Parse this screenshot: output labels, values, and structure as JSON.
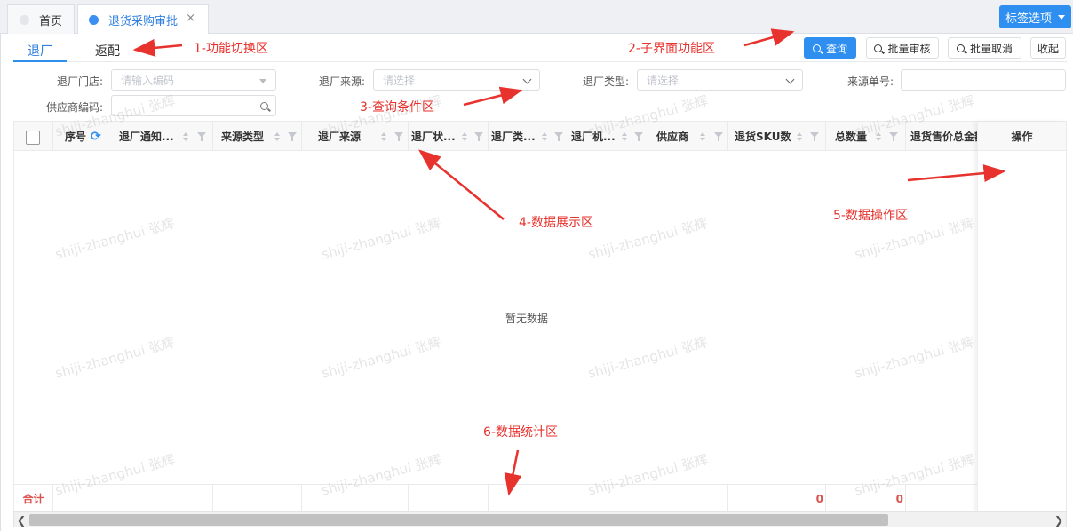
{
  "tabs": [
    {
      "label": "首页"
    },
    {
      "label": "退货采购审批",
      "close": "×"
    }
  ],
  "label_options": "标签选项",
  "func_tabs": [
    "退厂",
    "返配"
  ],
  "actions": {
    "query": "查询",
    "batch_review": "批量审核",
    "batch_cancel": "批量取消",
    "collapse": "收起"
  },
  "filters": {
    "store": {
      "label": "退厂门店:",
      "placeholder": "请输入编码"
    },
    "source": {
      "label": "退厂来源:",
      "placeholder": "请选择"
    },
    "type": {
      "label": "退厂类型:",
      "placeholder": "请选择"
    },
    "source_no": {
      "label": "来源单号:",
      "placeholder": ""
    },
    "supplier_code": {
      "label": "供应商编码:",
      "placeholder": ""
    }
  },
  "columns": [
    "序号",
    "退厂通知...",
    "来源类型",
    "退厂来源",
    "退厂状...",
    "退厂类...",
    "退厂机...",
    "供应商",
    "退货SKU数",
    "总数量",
    "退货售价总金额",
    "操作"
  ],
  "empty_text": "暂无数据",
  "summary": {
    "label": "合计",
    "sku_count": "0",
    "total_qty": "0"
  },
  "watermark": "shiji-zhanghui 张辉",
  "annotations": [
    "1-功能切换区",
    "2-子界面功能区",
    "3-查询条件区",
    "4-数据展示区",
    "5-数据操作区",
    "6-数据统计区"
  ],
  "colors": {
    "primary": "#2f8ff0",
    "annotation": "#e8322d",
    "sum_value": "#d9534f"
  }
}
